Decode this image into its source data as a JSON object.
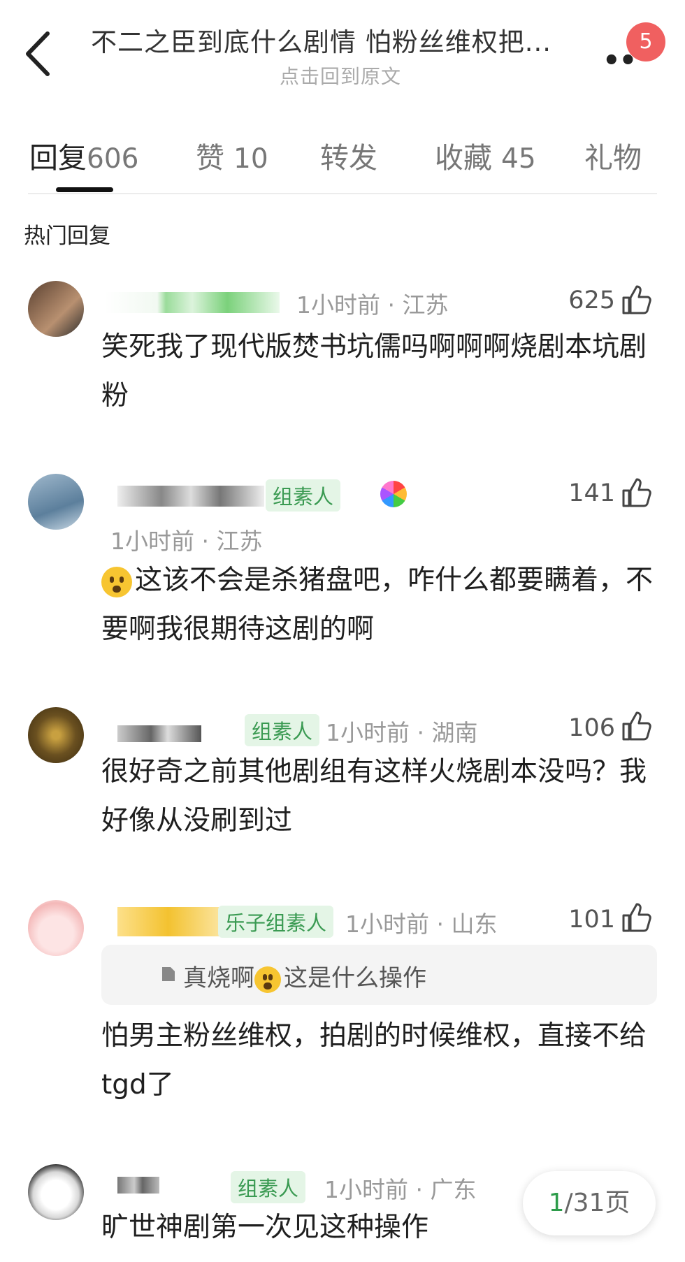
{
  "header": {
    "title": "不二之臣到底什么剧情   怕粉丝维权把...",
    "subtitle": "点击回到原文",
    "more": "••",
    "badge": "5"
  },
  "tabs": [
    {
      "label": "回复",
      "count": "606",
      "active": true
    },
    {
      "label": "赞",
      "count": "10"
    },
    {
      "label": "转发",
      "count": ""
    },
    {
      "label": "收藏",
      "count": "45"
    },
    {
      "label": "礼物",
      "count": ""
    }
  ],
  "section_title": "热门回复",
  "comments": [
    {
      "meta": "1小时前 · 江苏",
      "likes": "625",
      "text": "笑死我了现代版焚书坑儒吗啊啊啊烧剧本坑剧粉"
    },
    {
      "tag": "组素人",
      "meta": "1小时前 · 江苏",
      "likes": "141",
      "text": "这该不会是杀猪盘吧，咋什么都要瞒着，不要啊我很期待这剧的啊"
    },
    {
      "tag": "组素人",
      "meta": "1小时前 · 湖南",
      "likes": "106",
      "text": "很好奇之前其他剧组有这样火烧剧本没吗？我好像从没刷到过"
    },
    {
      "tag": "乐子组素人",
      "meta": "1小时前 · 山东",
      "likes": "101",
      "quote_a": "真烧啊",
      "quote_b": "这是什么操作",
      "text": "怕男主粉丝维权，拍剧的时候维权，直接不给tgd了"
    },
    {
      "tag": "组素人",
      "meta": "1小时前 · 广东",
      "text": "旷世神剧第一次见这种操作"
    }
  ],
  "pager": {
    "current": "1",
    "total": "/31页"
  },
  "colors": {
    "accent_green": "#3a9a52",
    "badge_red": "#f06060"
  }
}
